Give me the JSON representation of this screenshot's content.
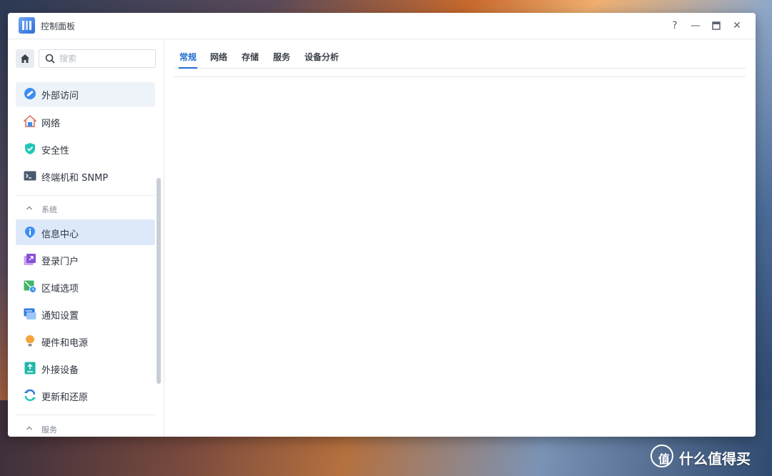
{
  "window": {
    "title": "控制面板",
    "controls": {
      "help": "?",
      "minimize": "—",
      "maximize": "▭",
      "close": "✕"
    }
  },
  "sidebar": {
    "search_placeholder": "搜索",
    "items_top": [
      {
        "label": "外部访问",
        "icon": "external-access-icon"
      },
      {
        "label": "网络",
        "icon": "network-icon"
      },
      {
        "label": "安全性",
        "icon": "security-shield-icon"
      },
      {
        "label": "终端机和 SNMP",
        "icon": "terminal-icon"
      }
    ],
    "section_system": "系统",
    "items_system": [
      {
        "label": "信息中心",
        "icon": "info-center-icon"
      },
      {
        "label": "登录门户",
        "icon": "login-portal-icon"
      },
      {
        "label": "区域选项",
        "icon": "regional-options-icon"
      },
      {
        "label": "通知设置",
        "icon": "notification-icon"
      },
      {
        "label": "硬件和电源",
        "icon": "hardware-power-icon"
      },
      {
        "label": "外接设备",
        "icon": "external-devices-icon"
      },
      {
        "label": "更新和还原",
        "icon": "update-restore-icon"
      }
    ],
    "section_services": "服务"
  },
  "tabs": [
    "常规",
    "网络",
    "存储",
    "服务",
    "设备分析"
  ],
  "active_tab": "常规",
  "colors": {
    "accent": "#1f6fd1",
    "selected_bg": "#dde9f8"
  },
  "watermark": {
    "text": "什么值得买",
    "logo_char": "值"
  }
}
